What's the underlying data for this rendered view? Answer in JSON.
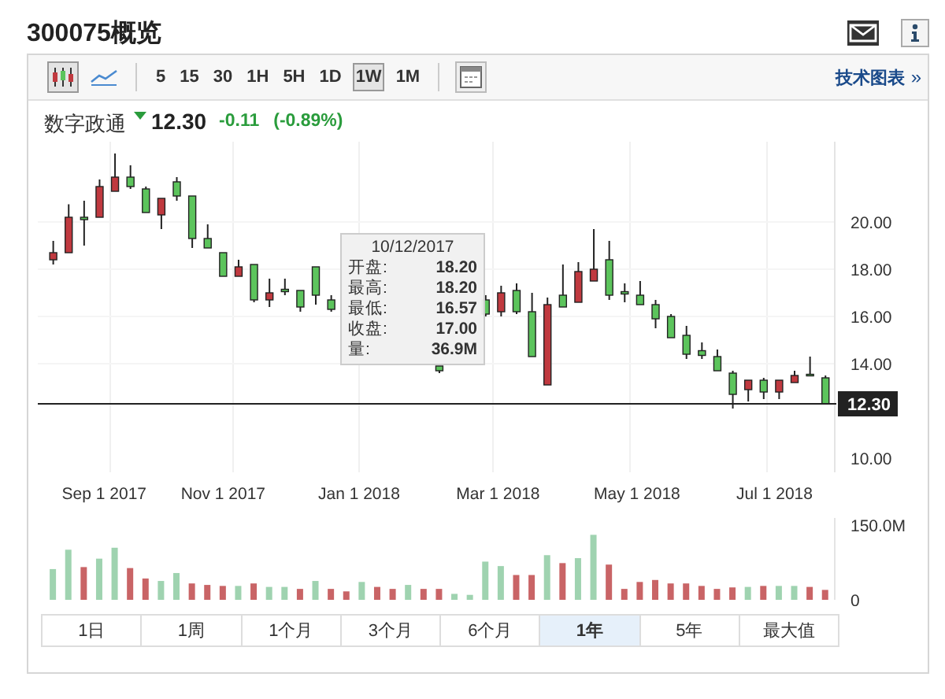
{
  "title": "300075概览",
  "toolbar": {
    "chart_types": [
      {
        "kind": "candle",
        "selected": true
      },
      {
        "kind": "line",
        "selected": false
      }
    ],
    "intervals": [
      {
        "label": "5",
        "selected": false
      },
      {
        "label": "15",
        "selected": false
      },
      {
        "label": "30",
        "selected": false
      },
      {
        "label": "1H",
        "selected": false
      },
      {
        "label": "5H",
        "selected": false
      },
      {
        "label": "1D",
        "selected": false
      },
      {
        "label": "1W",
        "selected": true
      },
      {
        "label": "1M",
        "selected": false
      }
    ],
    "link": "技术图表",
    "link_arrow": "»"
  },
  "quote": {
    "name": "数字政通",
    "price": "12.30",
    "change": "-0.11",
    "change_pct": "(-0.89%)"
  },
  "tooltip": {
    "date": "10/12/2017",
    "rows": [
      {
        "label": "开盘:",
        "value": "18.20"
      },
      {
        "label": "最高:",
        "value": "18.20"
      },
      {
        "label": "最低:",
        "value": "16.57"
      },
      {
        "label": "收盘:",
        "value": "17.00"
      },
      {
        "label": "量:",
        "value": "36.9M"
      }
    ]
  },
  "price_chart": {
    "chart_data": {
      "type": "candlestick",
      "grid": true,
      "ylim": [
        9.4,
        23.4
      ],
      "yticks": [
        {
          "value": 20,
          "label": "20.00"
        },
        {
          "value": 18,
          "label": "18.00"
        },
        {
          "value": 16,
          "label": "16.00"
        },
        {
          "value": 14,
          "label": "14.00"
        },
        {
          "value": 10,
          "label": "10.00"
        }
      ],
      "ref_lines": [
        {
          "axis": "y",
          "value": 12.3,
          "label": "12.30",
          "color": "#222222"
        }
      ],
      "categories": [
        null,
        null,
        null,
        null,
        null,
        null,
        null,
        null,
        null,
        null,
        null,
        null,
        null,
        null,
        null,
        null,
        null,
        null,
        null,
        null,
        null,
        null,
        null,
        null,
        null,
        null,
        null,
        null,
        null,
        null,
        null,
        null,
        null,
        null,
        null,
        null,
        null,
        null,
        null,
        null,
        null,
        null,
        null,
        null,
        null,
        null,
        null,
        null,
        null,
        null,
        null
      ],
      "ohlc": [
        [
          18.4,
          19.2,
          18.2,
          18.7
        ],
        [
          18.7,
          20.75,
          18.7,
          20.2
        ],
        [
          20.2,
          20.9,
          19.0,
          20.1
        ],
        [
          20.2,
          21.8,
          20.2,
          21.5
        ],
        [
          21.3,
          22.9,
          21.3,
          21.9
        ],
        [
          21.9,
          22.4,
          21.4,
          21.5
        ],
        [
          21.4,
          21.5,
          20.4,
          20.4
        ],
        [
          20.3,
          21.0,
          19.7,
          21.0
        ],
        [
          21.7,
          21.9,
          20.9,
          21.1
        ],
        [
          21.1,
          21.1,
          18.9,
          19.3
        ],
        [
          19.3,
          19.9,
          18.9,
          18.9
        ],
        [
          18.7,
          18.7,
          17.7,
          17.7
        ],
        [
          17.7,
          18.4,
          17.7,
          18.1
        ],
        [
          18.2,
          18.2,
          16.6,
          16.7
        ],
        [
          16.7,
          17.6,
          16.4,
          17.0
        ],
        [
          17.15,
          17.6,
          16.9,
          17.05
        ],
        [
          17.1,
          17.1,
          16.2,
          16.4
        ],
        [
          18.1,
          18.1,
          16.5,
          16.9
        ],
        [
          16.7,
          16.9,
          16.2,
          16.3
        ],
        null,
        null,
        null,
        null,
        null,
        null,
        [
          13.9,
          13.9,
          13.6,
          13.7
        ],
        null,
        null,
        [
          16.7,
          16.9,
          16.0,
          16.1
        ],
        [
          16.2,
          17.3,
          16.0,
          17.0
        ],
        [
          17.1,
          17.4,
          16.1,
          16.2
        ],
        [
          16.2,
          17.0,
          14.3,
          14.3
        ],
        [
          13.1,
          16.8,
          13.1,
          16.5
        ],
        [
          16.9,
          18.2,
          16.4,
          16.4
        ],
        [
          16.6,
          18.3,
          16.6,
          17.9
        ],
        [
          17.5,
          19.7,
          17.5,
          18.0
        ],
        [
          18.4,
          19.2,
          16.7,
          16.9
        ],
        [
          17.05,
          17.4,
          16.6,
          16.95
        ],
        [
          16.9,
          17.5,
          16.5,
          16.5
        ],
        [
          16.5,
          16.7,
          15.5,
          15.9
        ],
        [
          16.0,
          16.1,
          15.1,
          15.1
        ],
        [
          15.2,
          15.6,
          14.2,
          14.4
        ],
        [
          14.55,
          14.9,
          14.2,
          14.35
        ],
        [
          14.3,
          14.6,
          13.7,
          13.7
        ],
        [
          13.6,
          13.7,
          12.1,
          12.7
        ],
        [
          12.9,
          13.3,
          12.4,
          13.3
        ],
        [
          13.3,
          13.4,
          12.5,
          12.8
        ],
        [
          12.8,
          13.3,
          12.5,
          13.3
        ],
        [
          13.2,
          13.7,
          13.2,
          13.5
        ],
        [
          13.55,
          14.3,
          13.5,
          13.5
        ],
        [
          13.4,
          13.5,
          12.3,
          12.3
        ]
      ]
    }
  },
  "date_axis": [
    "Sep 1 2017",
    "Nov 1 2017",
    "Jan 1 2018",
    "Mar 1 2018",
    "May 1 2018",
    "Jul 1 2018"
  ],
  "volume_chart": {
    "chart_data": {
      "type": "bar",
      "stacked": true,
      "ylim": [
        0,
        165
      ],
      "categories": [
        null,
        null,
        null,
        null,
        null,
        null,
        null,
        null,
        null,
        null,
        null,
        null,
        null,
        null,
        null,
        null,
        null,
        null,
        null,
        null,
        null,
        null,
        null,
        null,
        null,
        null,
        null,
        null,
        null,
        null,
        null,
        null,
        null,
        null,
        null,
        null,
        null,
        null,
        null,
        null,
        null,
        null,
        null,
        null,
        null,
        null,
        null,
        null,
        null,
        null,
        null
      ],
      "yticks": [
        {
          "value": 150,
          "label": "150.0M"
        },
        {
          "value": 0,
          "label": "0"
        }
      ],
      "series": [
        {
          "color": "#9fd3b0",
          "values": [
            62,
            101,
            null,
            83,
            105,
            null,
            null,
            38,
            54,
            null,
            null,
            null,
            28,
            null,
            26,
            26,
            null,
            38,
            null,
            null,
            36,
            null,
            null,
            30,
            null,
            null,
            12,
            10,
            77,
            68,
            null,
            null,
            90,
            null,
            84,
            131,
            null,
            null,
            null,
            null,
            null,
            null,
            null,
            null,
            null,
            26,
            null,
            28,
            28,
            null,
            null
          ]
        },
        {
          "color": "#c96466",
          "values": [
            null,
            null,
            66,
            null,
            null,
            64,
            43,
            null,
            null,
            33,
            30,
            28,
            null,
            33,
            null,
            null,
            22,
            null,
            22,
            17,
            null,
            26,
            22,
            null,
            22,
            22,
            null,
            null,
            null,
            null,
            50,
            50,
            null,
            74,
            null,
            null,
            71,
            22,
            36,
            40,
            33,
            33,
            28,
            22,
            25,
            null,
            28,
            null,
            null,
            26,
            20
          ]
        }
      ]
    }
  },
  "ranges": [
    {
      "label": "1日",
      "selected": false
    },
    {
      "label": "1周",
      "selected": false
    },
    {
      "label": "1个月",
      "selected": false
    },
    {
      "label": "3个月",
      "selected": false
    },
    {
      "label": "6个月",
      "selected": false
    },
    {
      "label": "1年",
      "selected": true
    },
    {
      "label": "5年",
      "selected": false
    },
    {
      "label": "最大值",
      "selected": false
    }
  ]
}
